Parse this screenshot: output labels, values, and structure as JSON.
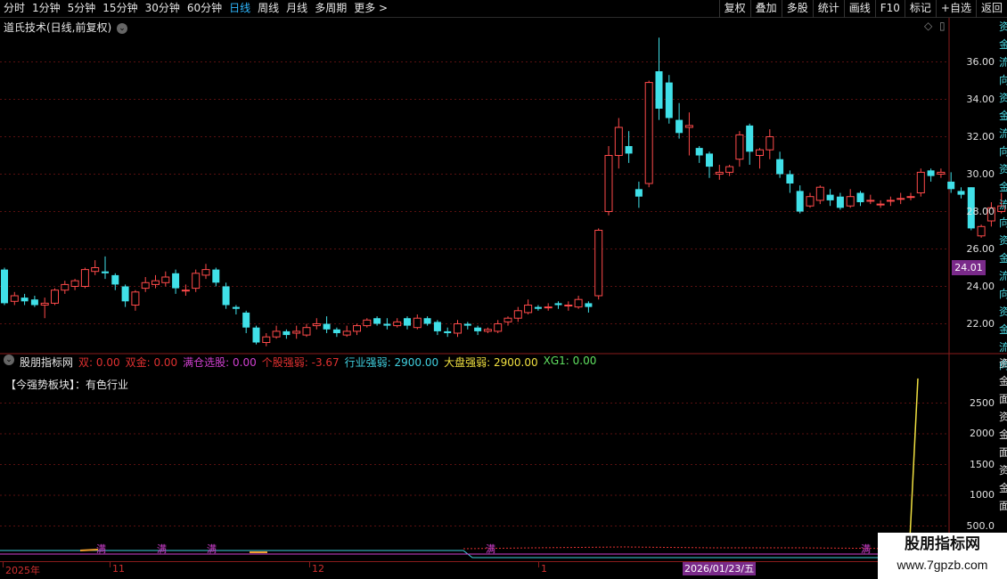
{
  "toolbar": {
    "tabs": [
      "分时",
      "1分钟",
      "5分钟",
      "15分钟",
      "30分钟",
      "60分钟",
      "日线",
      "周线",
      "月线",
      "多周期",
      "更多"
    ],
    "active_tab": "日线",
    "right_buttons": [
      "复权",
      "叠加",
      "多股",
      "统计",
      "画线",
      "F10",
      "标记",
      "+自选",
      "返回"
    ]
  },
  "main_chart": {
    "title": "道氏技术(日线,前复权)",
    "y_ticks": [
      "36.00",
      "34.00",
      "32.00",
      "30.00",
      "28.00",
      "26.00",
      "24.00",
      "22.00"
    ],
    "current_price": "24.01"
  },
  "indicator": {
    "name": "股朋指标网",
    "values": [
      {
        "label": "双: 0.00",
        "color": "#e03030"
      },
      {
        "label": "双金: 0.00",
        "color": "#e03030"
      },
      {
        "label": "满仓选股: 0.00",
        "color": "#d040d0"
      },
      {
        "label": "个股强弱: -3.67",
        "color": "#e03030"
      },
      {
        "label": "行业强弱: 2900.00",
        "color": "#40d0e0"
      },
      {
        "label": "大盘强弱: 2900.00",
        "color": "#f0e040"
      },
      {
        "label": "XG1: 0.00",
        "color": "#60e060"
      }
    ],
    "strong_sector": "【今强势板块】：有色行业",
    "y_ticks": [
      "2500",
      "2000",
      "1500",
      "1000",
      "500.0"
    ],
    "markers": [
      "满",
      "满",
      "满",
      "满",
      "满"
    ]
  },
  "time_axis": {
    "labels": [
      "2025年",
      "11",
      "12",
      "1"
    ],
    "cursor_date": "2026/01/23/五"
  },
  "right_strip": {
    "upper": "资金流向资金流向资金流向资金流向资金流向",
    "lower": "资金面资金面资金面"
  },
  "watermark": {
    "title": "股朋指标网",
    "url": "www.7gpzb.com"
  },
  "colors": {
    "up": "#ff4a4a",
    "down": "#40e0e8",
    "grid": "#5a1010",
    "accent": "#7a2a8a"
  },
  "chart_data": {
    "type": "candlestick",
    "ylim": [
      20.5,
      37.5
    ],
    "candles": [
      [
        24.9,
        23.1,
        25.0,
        23.0
      ],
      [
        23.2,
        23.5,
        23.7,
        23.0
      ],
      [
        23.4,
        23.2,
        23.6,
        23.0
      ],
      [
        23.3,
        23.0,
        23.5,
        22.9
      ],
      [
        23.0,
        23.1,
        23.4,
        22.3
      ],
      [
        23.1,
        23.8,
        23.9,
        23.0
      ],
      [
        23.8,
        24.1,
        24.3,
        23.6
      ],
      [
        24.0,
        24.3,
        24.4,
        23.8
      ],
      [
        24.0,
        24.9,
        25.0,
        23.9
      ],
      [
        24.8,
        25.0,
        25.4,
        24.6
      ],
      [
        24.8,
        24.7,
        25.6,
        24.4
      ],
      [
        24.6,
        24.1,
        24.7,
        23.8
      ],
      [
        24.0,
        23.2,
        24.1,
        22.9
      ],
      [
        23.0,
        23.7,
        23.8,
        22.7
      ],
      [
        23.9,
        24.2,
        24.5,
        23.7
      ],
      [
        24.1,
        24.3,
        24.6,
        23.9
      ],
      [
        24.2,
        24.5,
        24.8,
        24.0
      ],
      [
        24.7,
        23.9,
        24.9,
        23.6
      ],
      [
        23.8,
        23.8,
        24.1,
        23.5
      ],
      [
        23.9,
        24.7,
        24.9,
        23.7
      ],
      [
        24.6,
        24.9,
        25.2,
        24.4
      ],
      [
        24.9,
        24.2,
        25.0,
        24.0
      ],
      [
        24.0,
        23.0,
        24.2,
        22.8
      ],
      [
        22.9,
        22.8,
        23.0,
        22.5
      ],
      [
        22.6,
        21.8,
        22.7,
        21.5
      ],
      [
        21.8,
        21.0,
        21.9,
        20.9
      ],
      [
        21.0,
        21.3,
        21.5,
        20.8
      ],
      [
        21.3,
        21.6,
        21.9,
        21.2
      ],
      [
        21.6,
        21.4,
        21.7,
        21.2
      ],
      [
        21.5,
        21.6,
        21.9,
        21.2
      ],
      [
        21.4,
        21.8,
        22.0,
        21.3
      ],
      [
        21.9,
        22.0,
        22.3,
        21.7
      ],
      [
        22.0,
        21.7,
        22.4,
        21.5
      ],
      [
        21.7,
        21.5,
        21.8,
        21.3
      ],
      [
        21.4,
        21.6,
        21.9,
        21.3
      ],
      [
        21.6,
        21.9,
        22.0,
        21.4
      ],
      [
        21.9,
        22.2,
        22.3,
        21.8
      ],
      [
        22.3,
        22.0,
        22.4,
        21.9
      ],
      [
        22.0,
        21.9,
        22.3,
        21.7
      ],
      [
        21.9,
        22.1,
        22.3,
        21.8
      ],
      [
        22.3,
        21.9,
        22.4,
        21.7
      ],
      [
        21.8,
        22.3,
        22.5,
        21.7
      ],
      [
        22.3,
        22.0,
        22.4,
        21.9
      ],
      [
        22.1,
        21.6,
        22.2,
        21.4
      ],
      [
        21.6,
        21.5,
        21.8,
        21.3
      ],
      [
        21.5,
        22.0,
        22.2,
        21.3
      ],
      [
        22.0,
        21.9,
        22.1,
        21.7
      ],
      [
        21.8,
        21.6,
        21.9,
        21.4
      ],
      [
        21.6,
        21.7,
        21.8,
        21.5
      ],
      [
        21.6,
        22.0,
        22.2,
        21.5
      ],
      [
        22.1,
        22.3,
        22.4,
        21.9
      ],
      [
        22.3,
        22.7,
        22.9,
        22.1
      ],
      [
        22.6,
        23.0,
        23.3,
        22.5
      ],
      [
        22.9,
        22.8,
        23.0,
        22.7
      ],
      [
        22.9,
        22.9,
        23.1,
        22.7
      ],
      [
        23.1,
        23.0,
        23.2,
        22.8
      ],
      [
        23.0,
        23.0,
        23.2,
        22.7
      ],
      [
        22.9,
        23.3,
        23.5,
        22.8
      ],
      [
        23.1,
        22.9,
        23.2,
        22.6
      ],
      [
        23.5,
        27.0,
        27.1,
        23.3
      ],
      [
        28.0,
        31.0,
        31.5,
        27.8
      ],
      [
        31.0,
        32.5,
        33.0,
        30.3
      ],
      [
        31.5,
        31.1,
        32.3,
        30.6
      ],
      [
        29.2,
        28.8,
        29.6,
        28.2
      ],
      [
        29.5,
        34.9,
        35.0,
        29.3
      ],
      [
        35.5,
        33.5,
        37.3,
        32.9
      ],
      [
        34.9,
        33.0,
        35.3,
        32.7
      ],
      [
        32.9,
        32.2,
        33.8,
        31.9
      ],
      [
        32.5,
        32.6,
        33.3,
        31.0
      ],
      [
        31.4,
        31.0,
        31.5,
        30.6
      ],
      [
        31.1,
        30.4,
        31.2,
        29.8
      ],
      [
        30.0,
        30.1,
        30.5,
        29.7
      ],
      [
        30.1,
        30.4,
        30.5,
        29.9
      ],
      [
        30.8,
        32.1,
        32.3,
        30.4
      ],
      [
        32.6,
        31.2,
        32.7,
        30.5
      ],
      [
        31.0,
        31.3,
        31.4,
        30.3
      ],
      [
        31.3,
        32.0,
        32.4,
        30.8
      ],
      [
        30.8,
        30.0,
        31.2,
        29.8
      ],
      [
        30.0,
        29.5,
        30.2,
        29.0
      ],
      [
        29.1,
        28.0,
        29.4,
        27.9
      ],
      [
        28.3,
        28.8,
        29.0,
        28.2
      ],
      [
        28.6,
        29.3,
        29.4,
        28.4
      ],
      [
        28.9,
        28.6,
        29.2,
        28.3
      ],
      [
        28.8,
        28.2,
        29.0,
        28.1
      ],
      [
        28.3,
        28.8,
        29.2,
        28.2
      ],
      [
        29.0,
        28.5,
        29.1,
        28.3
      ],
      [
        28.6,
        28.6,
        28.9,
        28.4
      ],
      [
        28.4,
        28.4,
        28.6,
        28.2
      ],
      [
        28.6,
        28.6,
        28.8,
        28.3
      ],
      [
        28.7,
        28.7,
        29.0,
        28.4
      ],
      [
        28.8,
        28.8,
        29.0,
        28.6
      ],
      [
        29.0,
        30.1,
        30.3,
        28.8
      ],
      [
        30.2,
        29.9,
        30.3,
        29.6
      ],
      [
        30.0,
        30.1,
        30.3,
        29.8
      ],
      [
        29.6,
        29.2,
        30.1,
        29.0
      ],
      [
        29.1,
        28.9,
        29.3,
        28.7
      ],
      [
        29.3,
        27.1,
        29.3,
        27.0
      ],
      [
        26.7,
        27.2,
        27.3,
        26.6
      ],
      [
        27.5,
        28.2,
        28.5,
        27.2
      ],
      [
        28.0,
        28.3,
        29.0,
        27.9
      ]
    ],
    "indicator_lines": {
      "strength_yellow_end": 2900
    }
  }
}
